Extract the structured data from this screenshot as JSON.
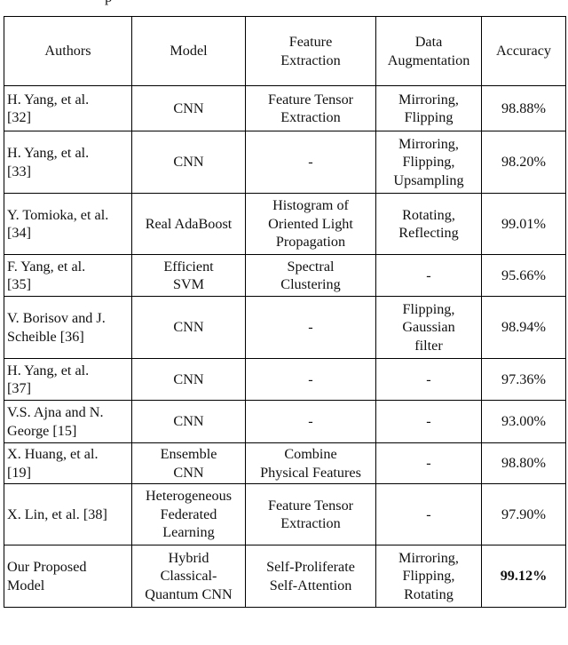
{
  "page": {
    "clipped_caption_fragment": "p",
    "background_color": "#ffffff",
    "text_color": "#111111",
    "border_color": "#000000"
  },
  "table": {
    "name": "model-comparison-table",
    "columns": [
      "Authors",
      "Model",
      "Feature\nExtraction",
      "Data\nAugmentation",
      "Accuracy"
    ],
    "headers": {
      "authors": "Authors",
      "model": "Model",
      "feature_extraction_line1": "Feature",
      "feature_extraction_line2": "Extraction",
      "data_augmentation_line1": "Data",
      "data_augmentation_line2": "Augmentation",
      "accuracy": "Accuracy"
    },
    "rows": [
      {
        "authors_line1": "H. Yang, et al.",
        "authors_line2": "[32]",
        "model_line1": "CNN",
        "model_line2": "",
        "model_line3": "",
        "feature_line1": "Feature Tensor",
        "feature_line2": "Extraction",
        "aug_line1": "Mirroring,",
        "aug_line2": "Flipping",
        "aug_line3": "",
        "accuracy": "98.88%",
        "accuracy_bold": false
      },
      {
        "authors_line1": "H. Yang, et al.",
        "authors_line2": "[33]",
        "model_line1": "CNN",
        "model_line2": "",
        "model_line3": "",
        "feature_line1": "-",
        "feature_line2": "",
        "aug_line1": "Mirroring,",
        "aug_line2": "Flipping,",
        "aug_line3": "Upsampling",
        "accuracy": "98.20%",
        "accuracy_bold": false
      },
      {
        "authors_line1": "Y. Tomioka, et al.",
        "authors_line2": "[34]",
        "model_line1": "Real AdaBoost",
        "model_line2": "",
        "model_line3": "",
        "feature_line1": "Histogram of",
        "feature_line2": "Oriented Light",
        "feature_line3": "Propagation",
        "aug_line1": "Rotating,",
        "aug_line2": "Reflecting",
        "aug_line3": "",
        "accuracy": "99.01%",
        "accuracy_bold": false
      },
      {
        "authors_line1": "F. Yang, et al.",
        "authors_line2": "[35]",
        "model_line1": "Efficient",
        "model_line2": "SVM",
        "model_line3": "",
        "feature_line1": "Spectral",
        "feature_line2": "Clustering",
        "aug_line1": "-",
        "aug_line2": "",
        "aug_line3": "",
        "accuracy": "95.66%",
        "accuracy_bold": false
      },
      {
        "authors_line1": "V. Borisov and J.",
        "authors_line2": "Scheible [36]",
        "model_line1": "CNN",
        "model_line2": "",
        "model_line3": "",
        "feature_line1": "-",
        "feature_line2": "",
        "aug_line1": "Flipping,",
        "aug_line2": "Gaussian",
        "aug_line3": "filter",
        "accuracy": "98.94%",
        "accuracy_bold": false
      },
      {
        "authors_line1": "H. Yang, et al.",
        "authors_line2": "[37]",
        "model_line1": "CNN",
        "model_line2": "",
        "model_line3": "",
        "feature_line1": "-",
        "feature_line2": "",
        "aug_line1": "-",
        "aug_line2": "",
        "aug_line3": "",
        "accuracy": "97.36%",
        "accuracy_bold": false
      },
      {
        "authors_line1": "V.S. Ajna and N.",
        "authors_line2": "George [15]",
        "model_line1": "CNN",
        "model_line2": "",
        "model_line3": "",
        "feature_line1": "-",
        "feature_line2": "",
        "aug_line1": "-",
        "aug_line2": "",
        "aug_line3": "",
        "accuracy": "93.00%",
        "accuracy_bold": false
      },
      {
        "authors_line1": "X. Huang, et al.",
        "authors_line2": "[19]",
        "model_line1": "Ensemble",
        "model_line2": "CNN",
        "model_line3": "",
        "feature_line1": "Combine",
        "feature_line2": "Physical Features",
        "aug_line1": "-",
        "aug_line2": "",
        "aug_line3": "",
        "accuracy": "98.80%",
        "accuracy_bold": false
      },
      {
        "authors_line1": "X. Lin, et al. [38]",
        "authors_line2": "",
        "model_line1": "Heterogeneous",
        "model_line2": "Federated",
        "model_line3": "Learning",
        "feature_line1": "Feature Tensor",
        "feature_line2": "Extraction",
        "aug_line1": "-",
        "aug_line2": "",
        "aug_line3": "",
        "accuracy": "97.90%",
        "accuracy_bold": false
      },
      {
        "authors_line1": "Our Proposed",
        "authors_line2": "Model",
        "model_line1": "Hybrid",
        "model_line2": "Classical-",
        "model_line3": "Quantum CNN",
        "feature_line1": "Self-Proliferate",
        "feature_line2": "Self-Attention",
        "aug_line1": "Mirroring,",
        "aug_line2": "Flipping,",
        "aug_line3": "Rotating",
        "accuracy": "99.12%",
        "accuracy_bold": true
      }
    ]
  }
}
